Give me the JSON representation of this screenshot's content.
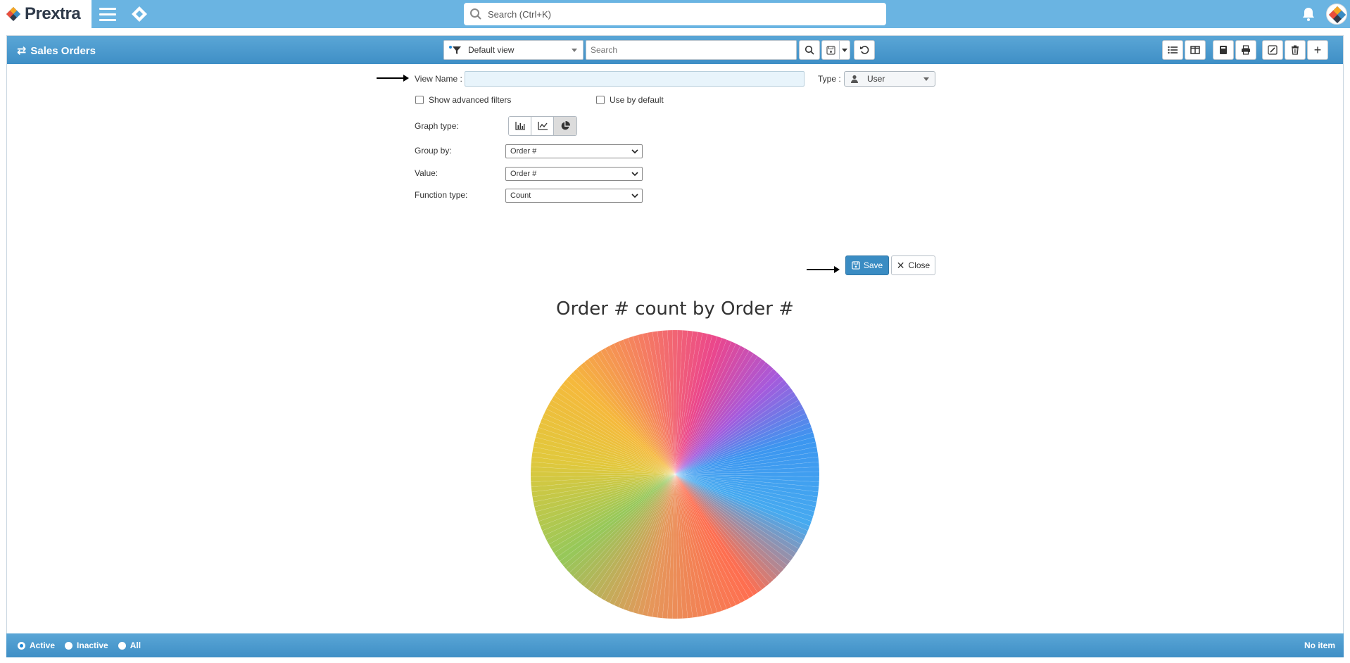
{
  "app": {
    "name": "Prextra"
  },
  "top_search": {
    "placeholder": "Search (Ctrl+K)"
  },
  "panel": {
    "title": "Sales Orders"
  },
  "toolbar": {
    "view_selected": "Default view",
    "search_placeholder": "Search"
  },
  "form": {
    "view_name_label": "View Name :",
    "view_name_value": "",
    "type_label": "Type :",
    "type_value": "User",
    "show_advanced_filters": "Show advanced filters",
    "use_by_default": "Use by default",
    "graph_type_label": "Graph type:",
    "graph_type_selected": "pie",
    "group_by_label": "Group by:",
    "group_by_value": "Order #",
    "value_label": "Value:",
    "value_value": "Order #",
    "function_type_label": "Function type:",
    "function_type_value": "Count"
  },
  "actions": {
    "save_label": "Save",
    "close_label": "Close"
  },
  "chart_data": {
    "type": "pie",
    "title": "Order # count by Order #",
    "note_colors": [
      "#e8508a",
      "#f06050",
      "#f5a623",
      "#e9d030",
      "#9acb4a",
      "#2ea8f0",
      "#7a5cd6",
      "#d0429a"
    ]
  },
  "footer": {
    "filters": [
      "Active",
      "Inactive",
      "All"
    ],
    "selected_filter": "Active",
    "status": "No item"
  },
  "colors": {
    "header": "#6ab4e2",
    "accent": "#3a8cc3"
  }
}
